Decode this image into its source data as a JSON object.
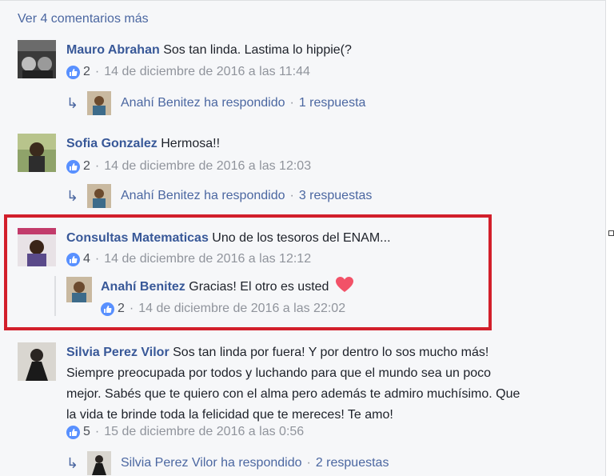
{
  "more_comments": "Ver 4 comentarios más",
  "comments": [
    {
      "author": "Mauro Abrahan",
      "text": "Sos tan linda. Lastima lo hippie(?",
      "likes": "2",
      "date": "14 de diciembre de 2016 a las 11:44",
      "reply_author": "Anahí Benitez ha respondido",
      "reply_count": "1 respuesta"
    },
    {
      "author": "Sofia Gonzalez",
      "text": "Hermosa!!",
      "likes": "2",
      "date": "14 de diciembre de 2016 a las 12:03",
      "reply_author": "Anahí Benitez ha respondido",
      "reply_count": "3 respuestas"
    },
    {
      "author": "Consultas Matematicas",
      "text": "Uno de los tesoros del ENAM...",
      "likes": "4",
      "date": "14 de diciembre de 2016 a las 12:12",
      "reply": {
        "author": "Anahí Benitez",
        "text": "Gracias! El otro es usted",
        "likes": "2",
        "date": "14 de diciembre de 2016 a las 22:02"
      }
    },
    {
      "author": "Silvia Perez Vilor",
      "text_lines": [
        "Sos tan linda por fuera! Y por dentro lo sos mucho más!",
        "Siempre preocupada por todos y luchando para que el mundo sea un poco",
        "mejor. Sabés que te quiero con el alma pero además te admiro muchísimo. Que",
        "la vida te brinde toda la felicidad que te mereces! Te amo!"
      ],
      "likes": "5",
      "date": "15 de diciembre de 2016 a las 0:56",
      "reply_author": "Silvia Perez Vilor ha respondido",
      "reply_count": "2 respuestas"
    }
  ],
  "separator": "·",
  "reply_arrow": "↳",
  "colors": {
    "link": "#385898",
    "highlight": "#d21f2b",
    "like": "#5890ff",
    "heart": "#f25268"
  }
}
